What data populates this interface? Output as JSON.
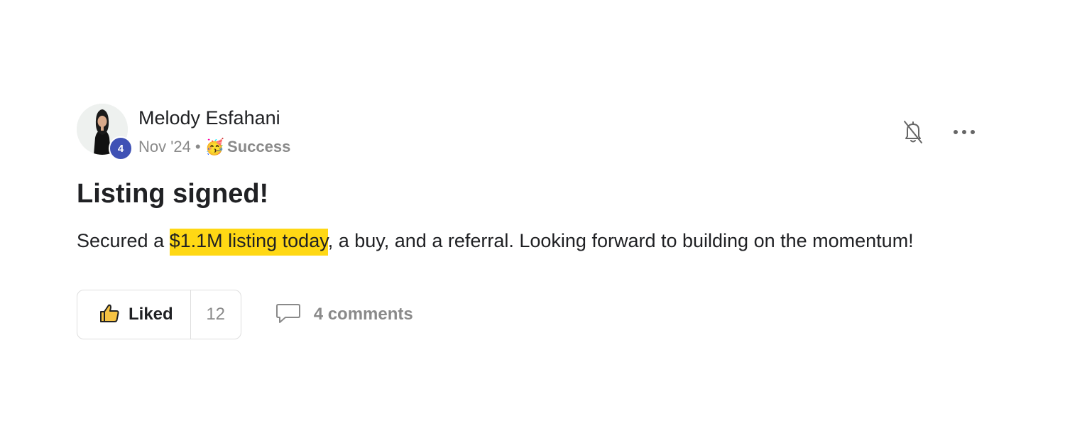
{
  "post": {
    "author": {
      "name": "Melody Esfahani",
      "level": "4"
    },
    "date": "Nov '24",
    "separator": "•",
    "category": {
      "emoji": "🥳",
      "label": "Success"
    },
    "title": "Listing signed!",
    "body": {
      "before": "Secured a ",
      "highlight": "$1.1M listing today",
      "after": ", a buy, and a referral. Looking forward to building on the momentum!"
    },
    "like": {
      "label": "Liked",
      "count": "12"
    },
    "comments": {
      "label": "4 comments"
    },
    "icons": {
      "notifications": "bell-off-icon",
      "more": "more-horizontal-icon",
      "like": "thumbs-up-icon",
      "comment": "comment-bubble-icon"
    },
    "colors": {
      "highlight": "#ffd814",
      "level_badge": "#3f51b5",
      "muted_text": "#8a8a8a"
    }
  }
}
